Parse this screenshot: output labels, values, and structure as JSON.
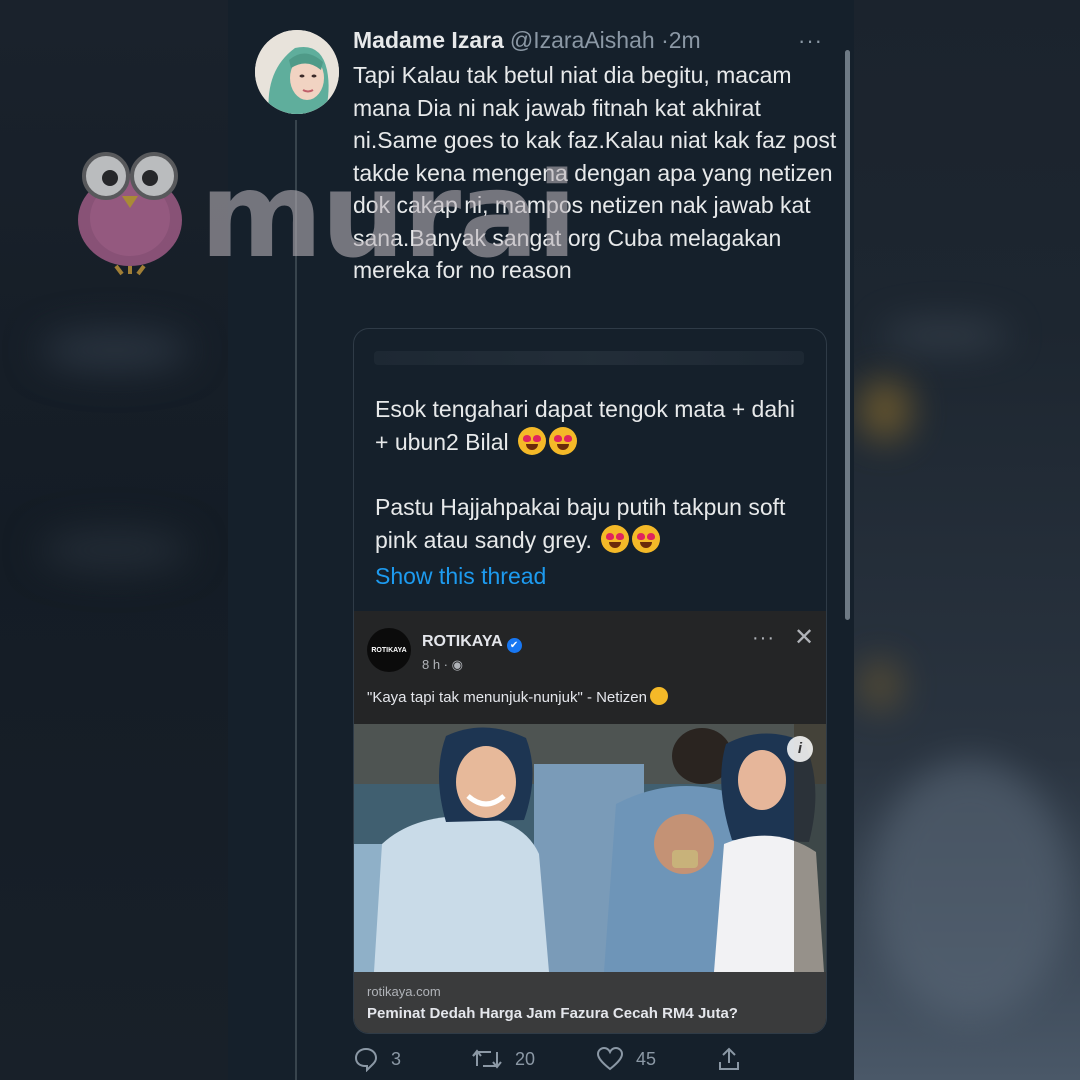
{
  "tweet": {
    "display_name": "Madame Izara",
    "handle": "@IzaraAishah",
    "separator": "·",
    "time": "2m",
    "more_icon": "···",
    "text": "Tapi Kalau tak betul niat dia begitu, macam mana Dia ni nak jawab fitnah kat akhirat ni.Same goes to kak faz.Kalau niat kak faz  post takde kena mengena dengan apa yang netizen dok cakap ni, mampos netizen nak jawab kat sana.Banyak sangat org Cuba melagakan mereka for no reason"
  },
  "quote": {
    "paragraph1": "Esok tengahari dapat tengok mata + dahi + ubun2 Bilal",
    "paragraph2": "Pastu Hajjahpakai baju putih takpun soft pink atau sandy grey.",
    "show_thread": "Show this thread",
    "emoji": "heart-eyes-emoji"
  },
  "embed": {
    "logo_text": "ROTIKAYA",
    "page_name": "ROTIKAYA",
    "verified_icon": "✔",
    "meta": "8 h · ",
    "more_icon": "···",
    "close_icon": "✕",
    "caption": "\"Kaya tapi tak menunjuk-nunjuk\" - Netizen",
    "info_badge": "i",
    "domain": "rotikaya.com",
    "headline": "Peminat Dedah Harga Jam Fazura Cecah RM4 Juta?"
  },
  "actions": {
    "replies": "3",
    "retweets": "20",
    "likes": "45"
  },
  "watermark": {
    "text": "murai"
  },
  "colors": {
    "background": "#15202b",
    "link": "#1d9bf0",
    "muted": "#8b98a5"
  }
}
